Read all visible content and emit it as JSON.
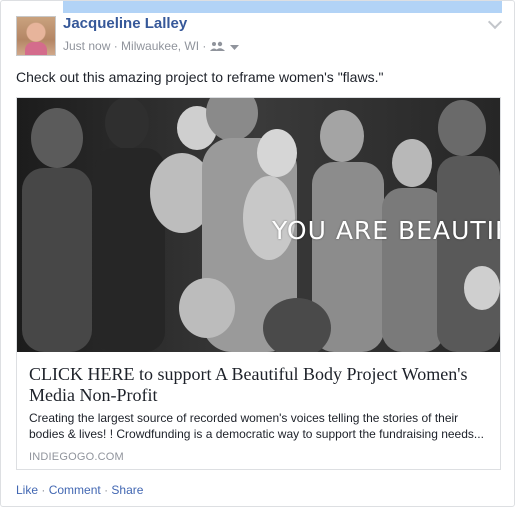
{
  "post": {
    "author": "Jacqueline Lalley",
    "time": "Just now",
    "separator": "·",
    "location": "Milwaukee, WI",
    "status_text": "Check out this amazing project to reframe women's \"flaws.\""
  },
  "link": {
    "image_overlay_text": "YOU ARE BEAUTIFUL",
    "title": "CLICK HERE to support A Beautiful Body Project Women's Media Non-Profit",
    "description": "Creating the largest source of recorded women's voices telling the stories of their bodies & lives! ! Crowdfunding is a democratic way to support the fundraising needs...",
    "domain": "INDIEGOGO.COM"
  },
  "actions": {
    "like": "Like",
    "comment": "Comment",
    "share": "Share",
    "separator": "·"
  },
  "colors": {
    "link_blue": "#365899",
    "action_blue": "#4267b2",
    "meta_gray": "#90949c",
    "top_bar": "#b2d3f6"
  },
  "icons": {
    "audience": "friends-icon",
    "dropdown": "chevron-down-icon",
    "post_menu": "chevron-down-icon"
  }
}
